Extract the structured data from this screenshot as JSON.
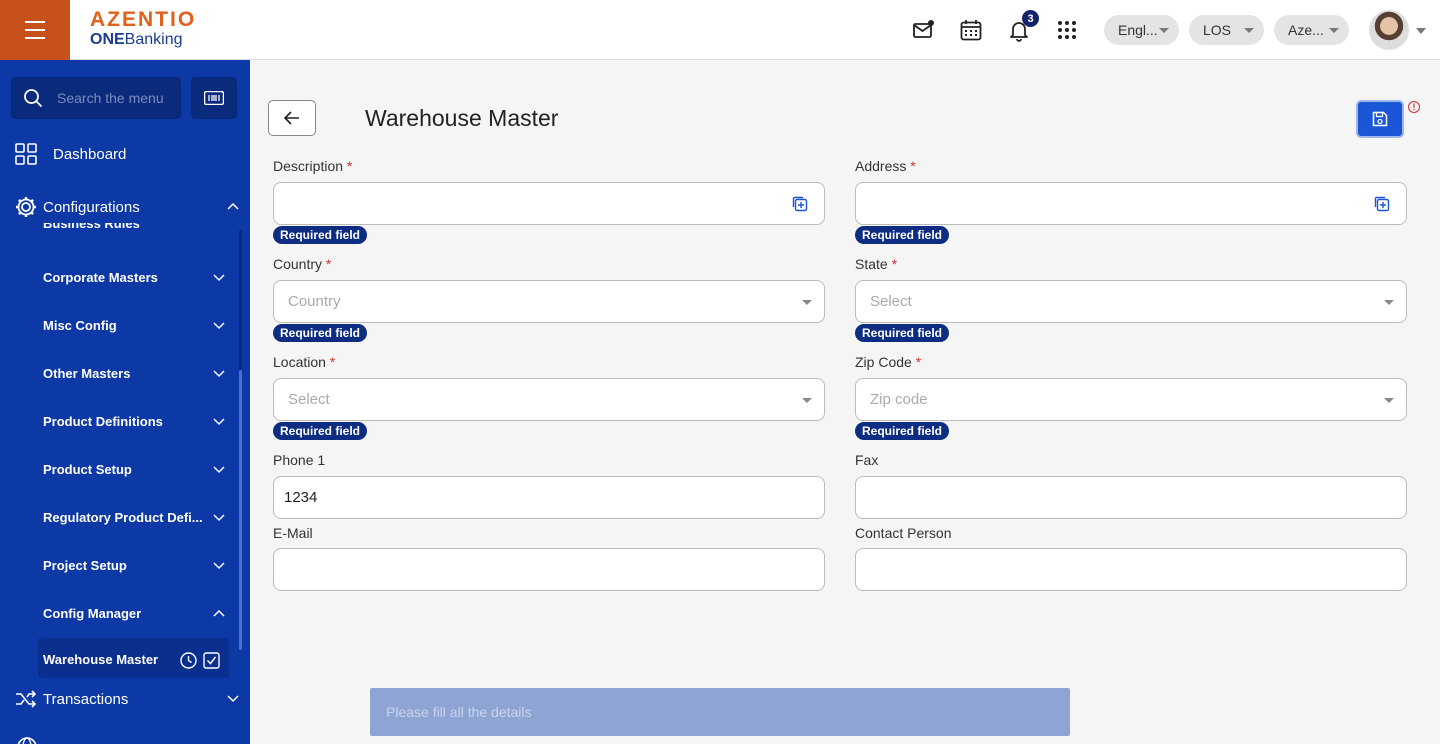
{
  "header": {
    "brand": "AZENTIO",
    "product_bold": "ONE",
    "product_rest": "Banking",
    "notification_count": "3",
    "language": "Engl...",
    "module": "LOS",
    "entity": "Aze..."
  },
  "sidebar": {
    "search_placeholder": "Search the menu",
    "dashboard": "Dashboard",
    "configurations": "Configurations",
    "partial_item": "Business Rules",
    "items": [
      {
        "label": "Corporate Masters"
      },
      {
        "label": "Misc Config"
      },
      {
        "label": "Other Masters"
      },
      {
        "label": "Product Definitions"
      },
      {
        "label": "Product Setup"
      },
      {
        "label": "Regulatory Product Defi..."
      },
      {
        "label": "Project Setup"
      },
      {
        "label": "Config Manager"
      }
    ],
    "active_item": "Warehouse Master",
    "transactions": "Transactions"
  },
  "page": {
    "title": "Warehouse Master",
    "save_warning": "!",
    "required_tag": "Required field",
    "fields": {
      "description": {
        "label": "Description",
        "value": ""
      },
      "address": {
        "label": "Address",
        "value": ""
      },
      "country": {
        "label": "Country",
        "placeholder": "Country"
      },
      "state": {
        "label": "State",
        "placeholder": "Select"
      },
      "location": {
        "label": "Location",
        "placeholder": "Select"
      },
      "zip": {
        "label": "Zip Code",
        "placeholder": "Zip code"
      },
      "phone1": {
        "label": "Phone 1",
        "value": "1234"
      },
      "fax": {
        "label": "Fax",
        "value": ""
      },
      "email": {
        "label": "E-Mail",
        "value": ""
      },
      "contact": {
        "label": "Contact Person",
        "value": ""
      }
    },
    "toast": "Please fill all the details"
  }
}
